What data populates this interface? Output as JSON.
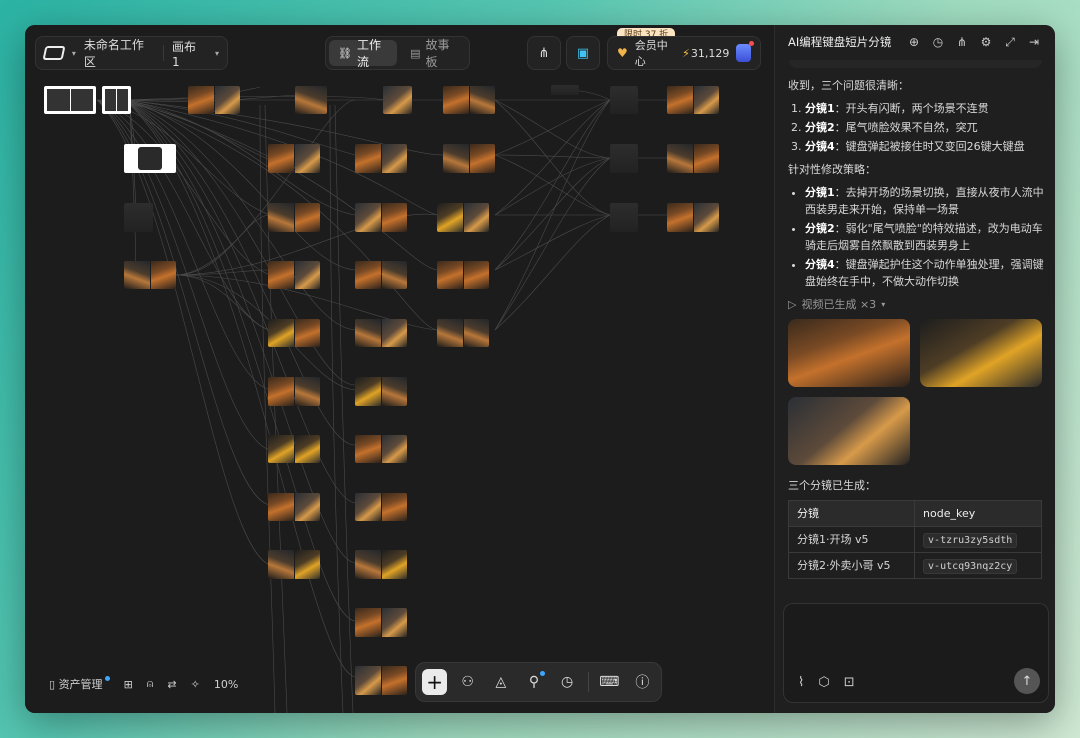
{
  "toolbar": {
    "workspace_name": "未命名工作区",
    "canvas_name": "画布 1",
    "tabs": [
      {
        "label": "工作流",
        "active": true
      },
      {
        "label": "故事板",
        "active": false
      }
    ],
    "promo": "限时 37 折",
    "vip_label": "会员中心",
    "credits": "31,129"
  },
  "bottom_left": {
    "assets_label": "资产管理",
    "zoom": "10%"
  },
  "panel": {
    "title": "AI编程键盘短片分镜",
    "intro": "收到，三个问题很清晰：",
    "issues": [
      {
        "key": "分镜1",
        "text": "：开头有闪断，两个场景不连贯"
      },
      {
        "key": "分镜2",
        "text": "：尾气喷脸效果不自然，突兀"
      },
      {
        "key": "分镜4",
        "text": "：键盘弹起被接住时又变回26键大键盘"
      }
    ],
    "strategy_title": "针对性修改策略：",
    "strategies": [
      {
        "key": "分镜1",
        "text": "：去掉开场的场景切换，直接从夜市人流中西装男走来开始，保持单一场景"
      },
      {
        "key": "分镜2",
        "text": "：弱化\"尾气喷脸\"的特效描述，改为电动车骑走后烟雾自然飘散到西装男身上"
      },
      {
        "key": "分镜4",
        "text": "：键盘弹起护住这个动作单独处理，强调键盘始终在手中，不做大动作切换"
      }
    ],
    "videos_label": "视频已生成 ×3",
    "done_label": "三个分镜已生成：",
    "table_headers": [
      "分镜",
      "node_key"
    ],
    "table_rows": [
      [
        "分镜1·开场 v5",
        "v-tzru3zy5sdth"
      ],
      [
        "分镜2·外卖小哥 v5",
        "v-utcq93nqz2cy"
      ]
    ]
  },
  "colors": {
    "accent_blue": "#3ea6ff",
    "promo_bg": "#fbe4c4",
    "vip_gold": "#f0b44a"
  }
}
